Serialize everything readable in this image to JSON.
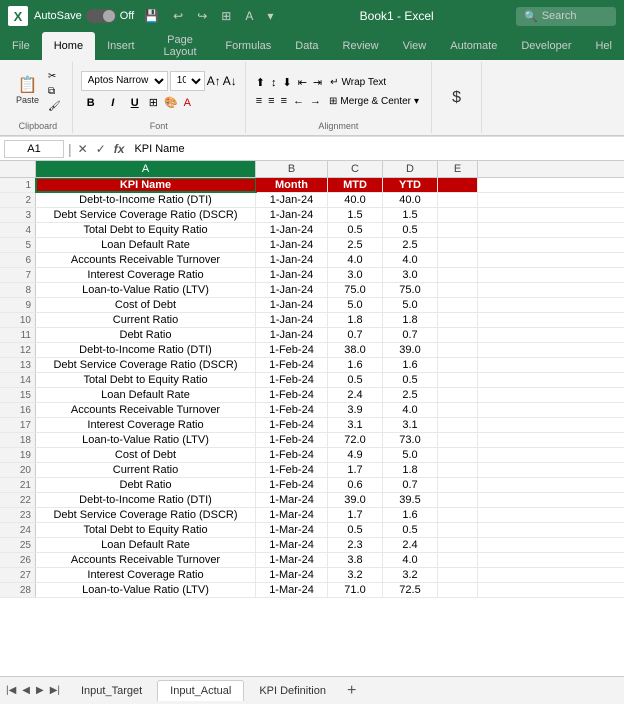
{
  "titleBar": {
    "appName": "Book1 - Excel",
    "autoSaveLabel": "AutoSave",
    "toggleState": "Off",
    "searchPlaceholder": "Search"
  },
  "ribbonTabs": [
    {
      "label": "File",
      "active": false
    },
    {
      "label": "Home",
      "active": true
    },
    {
      "label": "Insert",
      "active": false
    },
    {
      "label": "Page Layout",
      "active": false
    },
    {
      "label": "Formulas",
      "active": false
    },
    {
      "label": "Data",
      "active": false
    },
    {
      "label": "Review",
      "active": false
    },
    {
      "label": "View",
      "active": false
    },
    {
      "label": "Automate",
      "active": false
    },
    {
      "label": "Developer",
      "active": false
    },
    {
      "label": "Hel",
      "active": false
    }
  ],
  "ribbon": {
    "clipboard": "Clipboard",
    "font": "Font",
    "alignment": "Alignment",
    "pasteLabel": "Paste",
    "fontName": "Aptos Narrow",
    "fontSize": "10",
    "boldLabel": "B",
    "italicLabel": "I",
    "underlineLabel": "U",
    "wrapTextLabel": "Wrap Text",
    "mergeCenterLabel": "Merge & Center",
    "dollarLabel": "$"
  },
  "formulaBar": {
    "cellRef": "A1",
    "formula": "KPI Name",
    "xIcon": "✕",
    "checkIcon": "✓",
    "fxIcon": "fx"
  },
  "columns": [
    {
      "label": "A",
      "class": "col-a"
    },
    {
      "label": "B",
      "class": "col-b"
    },
    {
      "label": "C",
      "class": "col-c"
    },
    {
      "label": "D",
      "class": "col-d"
    },
    {
      "label": "E",
      "class": "col-e"
    }
  ],
  "headers": {
    "row": 1,
    "cells": [
      "KPI Name",
      "Month",
      "MTD",
      "YTD",
      ""
    ]
  },
  "rows": [
    {
      "num": 2,
      "kpi": "Debt-to-Income Ratio (DTI)",
      "month": "1-Jan-24",
      "mtd": "40.0",
      "ytd": "40.0"
    },
    {
      "num": 3,
      "kpi": "Debt Service Coverage Ratio (DSCR)",
      "month": "1-Jan-24",
      "mtd": "1.5",
      "ytd": "1.5"
    },
    {
      "num": 4,
      "kpi": "Total Debt to Equity Ratio",
      "month": "1-Jan-24",
      "mtd": "0.5",
      "ytd": "0.5"
    },
    {
      "num": 5,
      "kpi": "Loan Default Rate",
      "month": "1-Jan-24",
      "mtd": "2.5",
      "ytd": "2.5"
    },
    {
      "num": 6,
      "kpi": "Accounts Receivable Turnover",
      "month": "1-Jan-24",
      "mtd": "4.0",
      "ytd": "4.0"
    },
    {
      "num": 7,
      "kpi": "Interest Coverage Ratio",
      "month": "1-Jan-24",
      "mtd": "3.0",
      "ytd": "3.0"
    },
    {
      "num": 8,
      "kpi": "Loan-to-Value Ratio (LTV)",
      "month": "1-Jan-24",
      "mtd": "75.0",
      "ytd": "75.0"
    },
    {
      "num": 9,
      "kpi": "Cost of Debt",
      "month": "1-Jan-24",
      "mtd": "5.0",
      "ytd": "5.0"
    },
    {
      "num": 10,
      "kpi": "Current Ratio",
      "month": "1-Jan-24",
      "mtd": "1.8",
      "ytd": "1.8"
    },
    {
      "num": 11,
      "kpi": "Debt Ratio",
      "month": "1-Jan-24",
      "mtd": "0.7",
      "ytd": "0.7"
    },
    {
      "num": 12,
      "kpi": "Debt-to-Income Ratio (DTI)",
      "month": "1-Feb-24",
      "mtd": "38.0",
      "ytd": "39.0"
    },
    {
      "num": 13,
      "kpi": "Debt Service Coverage Ratio (DSCR)",
      "month": "1-Feb-24",
      "mtd": "1.6",
      "ytd": "1.6"
    },
    {
      "num": 14,
      "kpi": "Total Debt to Equity Ratio",
      "month": "1-Feb-24",
      "mtd": "0.5",
      "ytd": "0.5"
    },
    {
      "num": 15,
      "kpi": "Loan Default Rate",
      "month": "1-Feb-24",
      "mtd": "2.4",
      "ytd": "2.5"
    },
    {
      "num": 16,
      "kpi": "Accounts Receivable Turnover",
      "month": "1-Feb-24",
      "mtd": "3.9",
      "ytd": "4.0"
    },
    {
      "num": 17,
      "kpi": "Interest Coverage Ratio",
      "month": "1-Feb-24",
      "mtd": "3.1",
      "ytd": "3.1"
    },
    {
      "num": 18,
      "kpi": "Loan-to-Value Ratio (LTV)",
      "month": "1-Feb-24",
      "mtd": "72.0",
      "ytd": "73.0"
    },
    {
      "num": 19,
      "kpi": "Cost of Debt",
      "month": "1-Feb-24",
      "mtd": "4.9",
      "ytd": "5.0"
    },
    {
      "num": 20,
      "kpi": "Current Ratio",
      "month": "1-Feb-24",
      "mtd": "1.7",
      "ytd": "1.8"
    },
    {
      "num": 21,
      "kpi": "Debt Ratio",
      "month": "1-Feb-24",
      "mtd": "0.6",
      "ytd": "0.7"
    },
    {
      "num": 22,
      "kpi": "Debt-to-Income Ratio (DTI)",
      "month": "1-Mar-24",
      "mtd": "39.0",
      "ytd": "39.5"
    },
    {
      "num": 23,
      "kpi": "Debt Service Coverage Ratio (DSCR)",
      "month": "1-Mar-24",
      "mtd": "1.7",
      "ytd": "1.6"
    },
    {
      "num": 24,
      "kpi": "Total Debt to Equity Ratio",
      "month": "1-Mar-24",
      "mtd": "0.5",
      "ytd": "0.5"
    },
    {
      "num": 25,
      "kpi": "Loan Default Rate",
      "month": "1-Mar-24",
      "mtd": "2.3",
      "ytd": "2.4"
    },
    {
      "num": 26,
      "kpi": "Accounts Receivable Turnover",
      "month": "1-Mar-24",
      "mtd": "3.8",
      "ytd": "4.0"
    },
    {
      "num": 27,
      "kpi": "Interest Coverage Ratio",
      "month": "1-Mar-24",
      "mtd": "3.2",
      "ytd": "3.2"
    },
    {
      "num": 28,
      "kpi": "Loan-to-Value Ratio (LTV)",
      "month": "1-Mar-24",
      "mtd": "71.0",
      "ytd": "72.5"
    }
  ],
  "sheetTabs": [
    {
      "label": "Input_Target",
      "active": false
    },
    {
      "label": "Input_Actual",
      "active": true
    },
    {
      "label": "KPI Definition",
      "active": false
    }
  ]
}
